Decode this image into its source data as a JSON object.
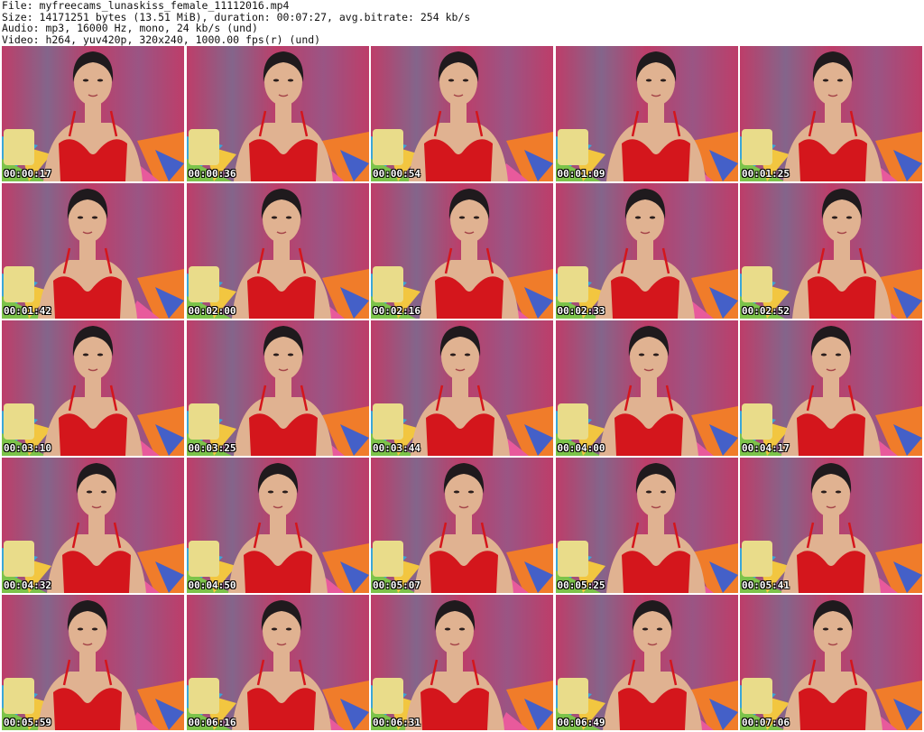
{
  "header": {
    "file_line": "File: myfreecams_lunaskiss_female_11112016.mp4",
    "size_line": "Size: 14171251 bytes (13.51 MiB), duration: 00:07:27, avg.bitrate: 254 kb/s",
    "audio_line": "Audio: mp3, 16000 Hz, mono, 24 kb/s (und)",
    "video_line": "Video: h264, yuv420p, 320x240, 1000.00 fps(r) (und)"
  },
  "thumbnails": [
    {
      "timestamp": "00:00:17"
    },
    {
      "timestamp": "00:00:36"
    },
    {
      "timestamp": "00:00:54"
    },
    {
      "timestamp": "00:01:09"
    },
    {
      "timestamp": "00:01:25"
    },
    {
      "timestamp": "00:01:42"
    },
    {
      "timestamp": "00:02:00"
    },
    {
      "timestamp": "00:02:16"
    },
    {
      "timestamp": "00:02:33"
    },
    {
      "timestamp": "00:02:52"
    },
    {
      "timestamp": "00:03:10"
    },
    {
      "timestamp": "00:03:25"
    },
    {
      "timestamp": "00:03:44"
    },
    {
      "timestamp": "00:04:00"
    },
    {
      "timestamp": "00:04:17"
    },
    {
      "timestamp": "00:04:32"
    },
    {
      "timestamp": "00:04:50"
    },
    {
      "timestamp": "00:05:07"
    },
    {
      "timestamp": "00:05:25"
    },
    {
      "timestamp": "00:05:41"
    },
    {
      "timestamp": "00:05:59"
    },
    {
      "timestamp": "00:06:16"
    },
    {
      "timestamp": "00:06:31"
    },
    {
      "timestamp": "00:06:49"
    },
    {
      "timestamp": "00:07:06"
    }
  ],
  "colors": {
    "curtain_pink": "#c8416f",
    "curtain_stripe": "#8c6b93",
    "clothing_red": "#d4161c",
    "skin": "#e0b291",
    "hair": "#1f1a1d",
    "pillow_yellow": "#e9dc8a"
  }
}
